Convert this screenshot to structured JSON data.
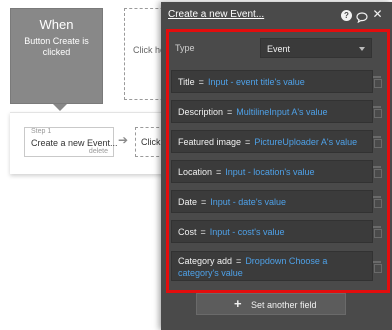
{
  "canvas": {
    "event_title": "When",
    "event_description": "Button Create is clicked",
    "placeholder_text": "Click he e",
    "step1": {
      "label": "Step 1",
      "title": "Create a new Event...",
      "delete": "delete"
    },
    "step2_text": "Click h"
  },
  "panel": {
    "title": "Create a new Event...",
    "help_icon": "?",
    "type_label": "Type",
    "type_value": "Event",
    "fields": [
      {
        "key": "Title",
        "value": "Input - event title's value"
      },
      {
        "key": "Description",
        "value": "MultilineInput A's value"
      },
      {
        "key": "Featured image",
        "value": "PictureUploader A's value"
      },
      {
        "key": "Location",
        "value": "Input - location's value"
      },
      {
        "key": "Date",
        "value": "Input - date's value"
      },
      {
        "key": "Cost",
        "value": "Input - cost's value"
      },
      {
        "key": "Category add",
        "value": "Dropdown Choose a category's value"
      }
    ],
    "set_another_field": "Set another field"
  },
  "colors": {
    "panel_bg": "#4a4a4a",
    "field_bg": "#3b3b3b",
    "value_text": "#4ea1e8",
    "highlight": "#e30d0d",
    "event_box": "#888888"
  },
  "icons": [
    "help-icon",
    "comment-icon",
    "close-icon",
    "trash-icon",
    "plus-icon",
    "chevron-down-icon",
    "arrow-right-icon"
  ]
}
